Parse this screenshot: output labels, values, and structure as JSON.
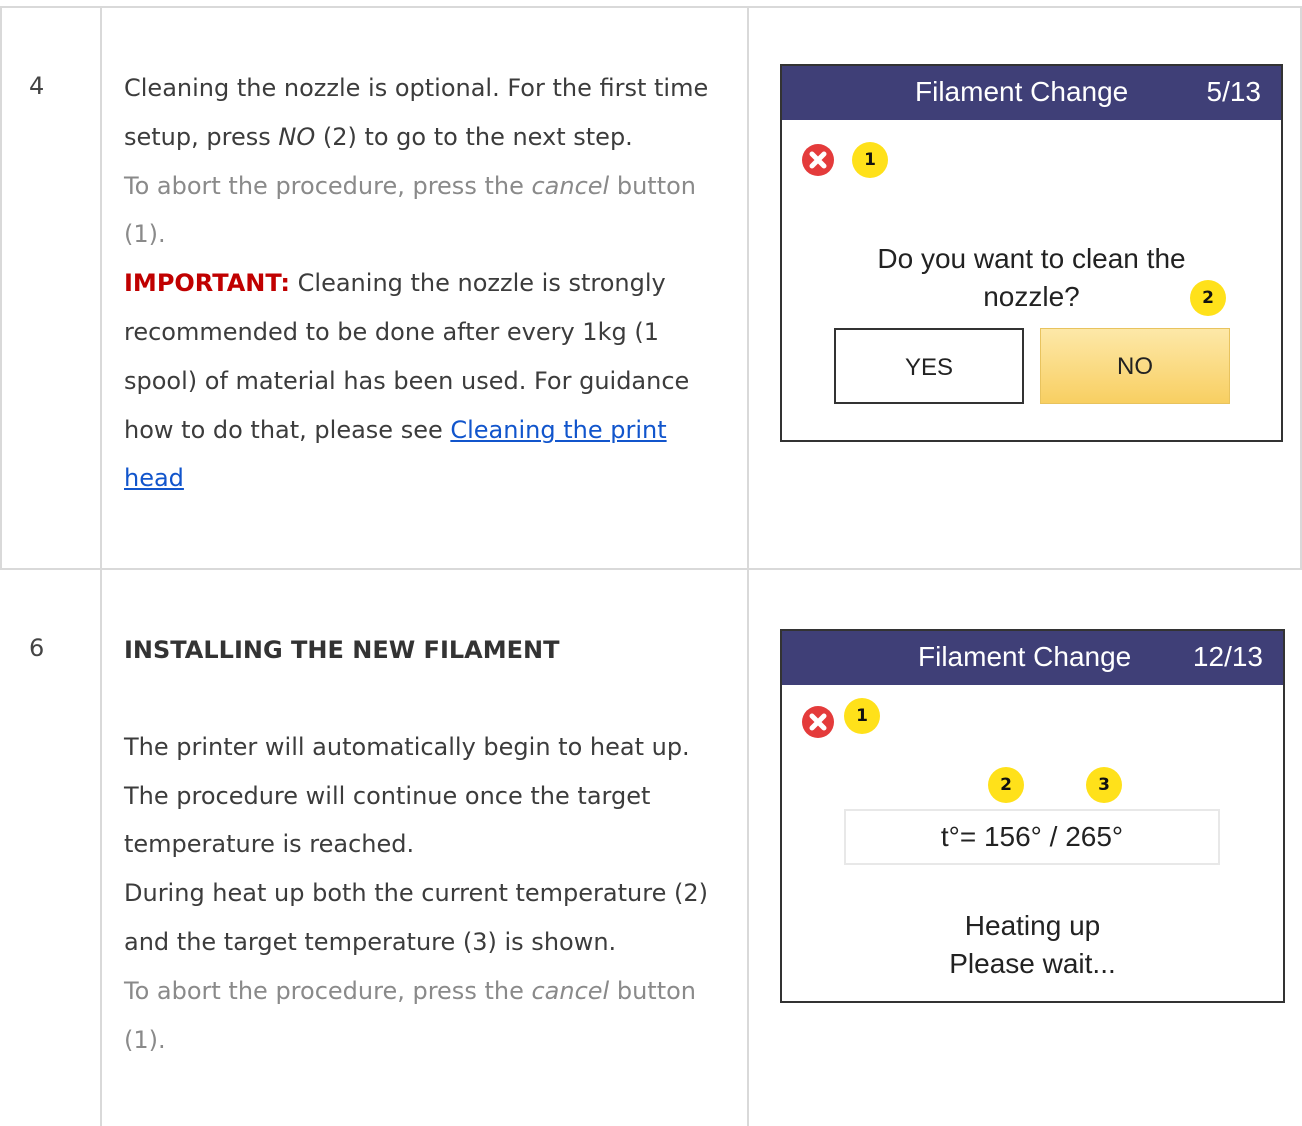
{
  "rows": [
    {
      "step": "4",
      "paragraphs": {
        "p1_a": "Cleaning the nozzle is optional. For the first time setup, press ",
        "p1_em": "NO",
        "p1_b": " (2) to go to the next step.",
        "p2_a": "To abort the procedure, press the ",
        "p2_em": "cancel",
        "p2_b": " button (1).",
        "p3_label": "IMPORTANT:",
        "p3_text": " Cleaning the nozzle is strongly recommended to be done after every 1kg (1 spool) of material has been used. For guidance how to do that, please see ",
        "link": "Cleaning the print head"
      },
      "screen": {
        "title": "Filament Change",
        "counter": "5/13",
        "callout_cancel": "1",
        "question": "Do you want to clean the nozzle?",
        "callout_no": "2",
        "yes_label": "YES",
        "no_label": "NO"
      }
    },
    {
      "step": "6",
      "paragraphs": {
        "heading": "INSTALLING THE NEW FILAMENT",
        "p1": "The printer will automatically begin to heat up. The procedure will continue once the target temperature is reached.",
        "p2": "During heat up both the current temperature (2) and the target temperature (3) is shown.",
        "p3_a": "To abort the procedure, press the ",
        "p3_em": "cancel",
        "p3_b": " button (1)."
      },
      "screen": {
        "title": "Filament Change",
        "counter": "12/13",
        "callout_cancel": "1",
        "callout_current": "2",
        "callout_target": "3",
        "temperature": "t°= 156° / 265°",
        "status_line1": "Heating up",
        "status_line2": "Please wait..."
      }
    }
  ],
  "colors": {
    "header_bg": "#3f3f77",
    "important": "#c00000",
    "link": "#1155cc",
    "callout": "#ffe11a",
    "cancel": "#e43b3b"
  }
}
